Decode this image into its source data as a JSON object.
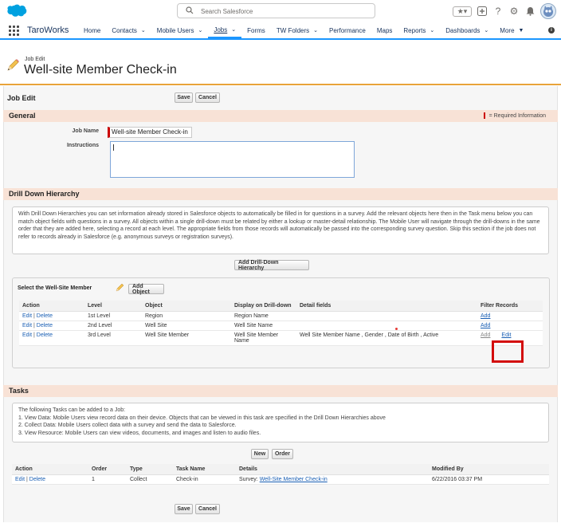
{
  "header": {
    "search_placeholder": "Search Salesforce"
  },
  "nav": {
    "app_name": "TaroWorks",
    "items": [
      {
        "label": "Home",
        "dropdown": false,
        "active": false
      },
      {
        "label": "Contacts",
        "dropdown": true,
        "active": false
      },
      {
        "label": "Mobile Users",
        "dropdown": true,
        "active": false
      },
      {
        "label": "Jobs",
        "dropdown": true,
        "active": true
      },
      {
        "label": "Forms",
        "dropdown": false,
        "active": false
      },
      {
        "label": "TW Folders",
        "dropdown": true,
        "active": false
      },
      {
        "label": "Performance",
        "dropdown": false,
        "active": false
      },
      {
        "label": "Maps",
        "dropdown": false,
        "active": false
      },
      {
        "label": "Reports",
        "dropdown": true,
        "active": false
      },
      {
        "label": "Dashboards",
        "dropdown": true,
        "active": false
      },
      {
        "label": "More",
        "dropdown": true,
        "active": false
      }
    ]
  },
  "page": {
    "subtitle": "Job Edit",
    "title": "Well-site Member Check-in"
  },
  "job_edit": {
    "title": "Job Edit",
    "save": "Save",
    "cancel": "Cancel"
  },
  "general": {
    "header": "General",
    "required_info": "= Required Information",
    "job_name_label": "Job Name",
    "job_name_value": "Well-site Member Check-in",
    "instructions_label": "Instructions"
  },
  "drill": {
    "header": "Drill Down Hierarchy",
    "info": "With Drill Down Hierarchies you can set information already stored in Salesforce objects to automatically be filled in for questions in a survey. Add the relevant objects here then in the Task menu below you can match object fields with questions in a survey. All objects within a single drill-down must be related by either a lookup or master-detail relationship. The Mobile User will navigate through the drill-downs in the same order that they are added here, selecting a record at each level. The appropriate fields from those records will automatically be passed into the corresponding survey question. Skip this section if the job does not refer to records already in Salesforce (e.g. anonymous surveys or registration surveys).",
    "add_button": "Add Drill-Down Hierarchy",
    "wellsite_title": "Select the Well-Site Member",
    "add_object": "Add Object",
    "columns": [
      "Action",
      "Level",
      "Object",
      "Display on Drill-down",
      "Detail fields",
      "Filter Records"
    ],
    "rows": [
      {
        "edit": "Edit",
        "delete": "Delete",
        "level": "1st Level",
        "object": "Region",
        "display": "Region Name",
        "detail": "",
        "add": "Add",
        "edit2": ""
      },
      {
        "edit": "Edit",
        "delete": "Delete",
        "level": "2nd Level",
        "object": "Well Site",
        "display": "Well Site Name",
        "detail": "",
        "add": "Add",
        "edit2": ""
      },
      {
        "edit": "Edit",
        "delete": "Delete",
        "level": "3rd Level",
        "object": "Well Site Member",
        "display": "Well Site Member Name",
        "detail": "Well Site Member Name , Gender , Date of Birth , Active",
        "add": "Add",
        "edit2": "Edit"
      }
    ]
  },
  "tasks": {
    "header": "Tasks",
    "info_lines": [
      "The following Tasks can be added to a Job:",
      "1. View Data: Mobile Users view record data on their device. Objects that can be viewed in this task are specified in the Drill Down Hierarchies above",
      "2. Collect Data: Mobile Users collect data with a survey and send the data to Salesforce.",
      "3. View Resource: Mobile Users can view videos, documents, and images and listen to audio files."
    ],
    "new": "New",
    "order": "Order",
    "columns": [
      "Action",
      "Order",
      "Type",
      "Task Name",
      "Details",
      "Modified By"
    ],
    "rows": [
      {
        "edit": "Edit",
        "delete": "Delete",
        "order": "1",
        "type": "Collect",
        "task_name": "Check-in",
        "details_prefix": "Survey:",
        "details_link": "Well-Site Member Check-in",
        "modified": "6/22/2016 03:37 PM"
      }
    ]
  },
  "footer": {
    "save": "Save",
    "cancel": "Cancel"
  },
  "colors": {
    "accent": "#1b96ff",
    "section_header": "#f8e2d6",
    "rule": "#e8a33a",
    "highlight": "#d30c0c",
    "required": "#cc0000"
  }
}
